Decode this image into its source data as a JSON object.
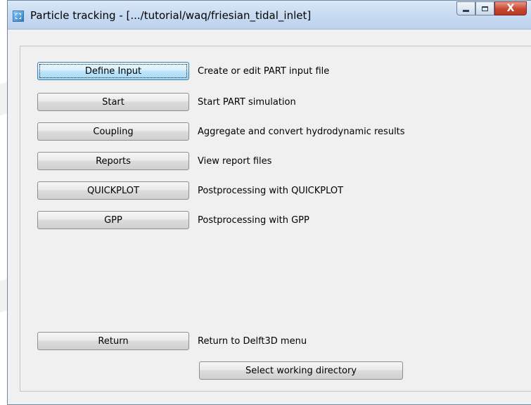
{
  "window": {
    "title": "Particle tracking - [.../tutorial/waq/friesian_tidal_inlet]",
    "minimize_glyph": "",
    "maximize_glyph": "",
    "close_glyph": "X"
  },
  "menu": [
    {
      "label": "Define Input",
      "description": "Create or edit PART input file"
    },
    {
      "label": "Start",
      "description": "Start PART simulation"
    },
    {
      "label": "Coupling",
      "description": "Aggregate and convert hydrodynamic results"
    },
    {
      "label": "Reports",
      "description": "View report files"
    },
    {
      "label": "QUICKPLOT",
      "description": "Postprocessing with QUICKPLOT"
    },
    {
      "label": "GPP",
      "description": "Postprocessing with GPP"
    }
  ],
  "return": {
    "label": "Return",
    "description": "Return to Delft3D menu"
  },
  "select_dir": {
    "label": "Select working directory"
  },
  "colors": {
    "titlebar": "#c9dcf2",
    "focused_button": "#bee6fd",
    "close_button": "#c8462f"
  }
}
